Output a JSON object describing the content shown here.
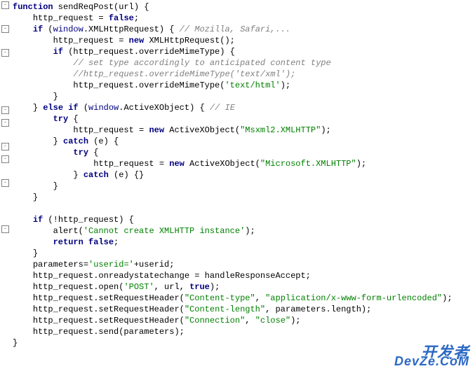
{
  "gutter": [
    "-",
    "",
    "-",
    "",
    "-",
    "",
    "",
    "",
    "",
    "-",
    "-",
    "",
    "-",
    "-",
    "",
    "-",
    "",
    "",
    "",
    "-",
    "",
    "",
    "",
    "",
    "",
    "",
    "",
    "",
    "",
    "",
    "",
    ""
  ],
  "code": [
    {
      "ind": 0,
      "seg": [
        {
          "c": "kw",
          "t": "function"
        },
        {
          "t": " sendReqPost(url) {"
        }
      ]
    },
    {
      "ind": 1,
      "seg": [
        {
          "t": "http_request = "
        },
        {
          "c": "kw",
          "t": "false"
        },
        {
          "t": ";"
        }
      ]
    },
    {
      "ind": 1,
      "seg": [
        {
          "c": "kw",
          "t": "if"
        },
        {
          "t": " ("
        },
        {
          "c": "bi",
          "t": "window"
        },
        {
          "t": ".XMLHttpRequest) { "
        },
        {
          "c": "cm",
          "t": "// Mozilla, Safari,..."
        }
      ]
    },
    {
      "ind": 2,
      "seg": [
        {
          "t": "http_request = "
        },
        {
          "c": "kw",
          "t": "new"
        },
        {
          "t": " XMLHttpRequest();"
        }
      ]
    },
    {
      "ind": 2,
      "seg": [
        {
          "c": "kw",
          "t": "if"
        },
        {
          "t": " (http_request.overrideMimeType) {"
        }
      ]
    },
    {
      "ind": 3,
      "seg": [
        {
          "c": "cm",
          "t": "// set type accordingly to anticipated content type"
        }
      ]
    },
    {
      "ind": 3,
      "seg": [
        {
          "c": "cm",
          "t": "//http_request.overrideMimeType('text/xml');"
        }
      ]
    },
    {
      "ind": 3,
      "seg": [
        {
          "t": "http_request.overrideMimeType("
        },
        {
          "c": "str",
          "t": "'text/html'"
        },
        {
          "t": ");"
        }
      ]
    },
    {
      "ind": 2,
      "seg": [
        {
          "t": "}"
        }
      ]
    },
    {
      "ind": 1,
      "seg": [
        {
          "t": "} "
        },
        {
          "c": "kw",
          "t": "else if"
        },
        {
          "t": " ("
        },
        {
          "c": "bi",
          "t": "window"
        },
        {
          "t": ".ActiveXObject) { "
        },
        {
          "c": "cm",
          "t": "// IE"
        }
      ]
    },
    {
      "ind": 2,
      "seg": [
        {
          "c": "kw",
          "t": "try"
        },
        {
          "t": " {"
        }
      ]
    },
    {
      "ind": 3,
      "seg": [
        {
          "t": "http_request = "
        },
        {
          "c": "kw",
          "t": "new"
        },
        {
          "t": " ActiveXObject("
        },
        {
          "c": "str",
          "t": "\"Msxml2.XMLHTTP\""
        },
        {
          "t": ");"
        }
      ]
    },
    {
      "ind": 2,
      "seg": [
        {
          "t": "} "
        },
        {
          "c": "kw",
          "t": "catch"
        },
        {
          "t": " (e) {"
        }
      ]
    },
    {
      "ind": 3,
      "seg": [
        {
          "c": "kw",
          "t": "try"
        },
        {
          "t": " {"
        }
      ]
    },
    {
      "ind": 4,
      "seg": [
        {
          "t": "http_request = "
        },
        {
          "c": "kw",
          "t": "new"
        },
        {
          "t": " ActiveXObject("
        },
        {
          "c": "str",
          "t": "\"Microsoft.XMLHTTP\""
        },
        {
          "t": ");"
        }
      ]
    },
    {
      "ind": 3,
      "seg": [
        {
          "t": "} "
        },
        {
          "c": "kw",
          "t": "catch"
        },
        {
          "t": " (e) {}"
        }
      ]
    },
    {
      "ind": 2,
      "seg": [
        {
          "t": "}"
        }
      ]
    },
    {
      "ind": 1,
      "seg": [
        {
          "t": "}"
        }
      ]
    },
    {
      "ind": 0,
      "seg": [
        {
          "t": ""
        }
      ]
    },
    {
      "ind": 1,
      "seg": [
        {
          "c": "kw",
          "t": "if"
        },
        {
          "t": " (!http_request) {"
        }
      ]
    },
    {
      "ind": 2,
      "seg": [
        {
          "t": "alert("
        },
        {
          "c": "str",
          "t": "'Cannot create XMLHTTP instance'"
        },
        {
          "t": ");"
        }
      ]
    },
    {
      "ind": 2,
      "seg": [
        {
          "c": "kw",
          "t": "return false"
        },
        {
          "t": ";"
        }
      ]
    },
    {
      "ind": 1,
      "seg": [
        {
          "t": "}"
        }
      ]
    },
    {
      "ind": 1,
      "seg": [
        {
          "t": "parameters="
        },
        {
          "c": "str",
          "t": "'userid='"
        },
        {
          "t": "+userid;"
        }
      ]
    },
    {
      "ind": 1,
      "seg": [
        {
          "t": "http_request.onreadystatechange = handleResponseAccept;"
        }
      ]
    },
    {
      "ind": 1,
      "seg": [
        {
          "t": "http_request.open("
        },
        {
          "c": "str",
          "t": "'POST'"
        },
        {
          "t": ", url, "
        },
        {
          "c": "kw",
          "t": "true"
        },
        {
          "t": ");"
        }
      ]
    },
    {
      "ind": 1,
      "seg": [
        {
          "t": "http_request.setRequestHeader("
        },
        {
          "c": "str",
          "t": "\"Content-type\""
        },
        {
          "t": ", "
        },
        {
          "c": "str",
          "t": "\"application/x-www-form-urlencoded\""
        },
        {
          "t": ");"
        }
      ]
    },
    {
      "ind": 1,
      "seg": [
        {
          "t": "http_request.setRequestHeader("
        },
        {
          "c": "str",
          "t": "\"Content-length\""
        },
        {
          "t": ", parameters.length);"
        }
      ]
    },
    {
      "ind": 1,
      "seg": [
        {
          "t": "http_request.setRequestHeader("
        },
        {
          "c": "str",
          "t": "\"Connection\""
        },
        {
          "t": ", "
        },
        {
          "c": "str",
          "t": "\"close\""
        },
        {
          "t": ");"
        }
      ]
    },
    {
      "ind": 1,
      "seg": [
        {
          "t": "http_request.send(parameters);"
        }
      ]
    },
    {
      "ind": 0,
      "seg": [
        {
          "t": "}"
        }
      ]
    }
  ],
  "watermark": {
    "line1": "开发者",
    "line2": "DevZe.CoM"
  }
}
